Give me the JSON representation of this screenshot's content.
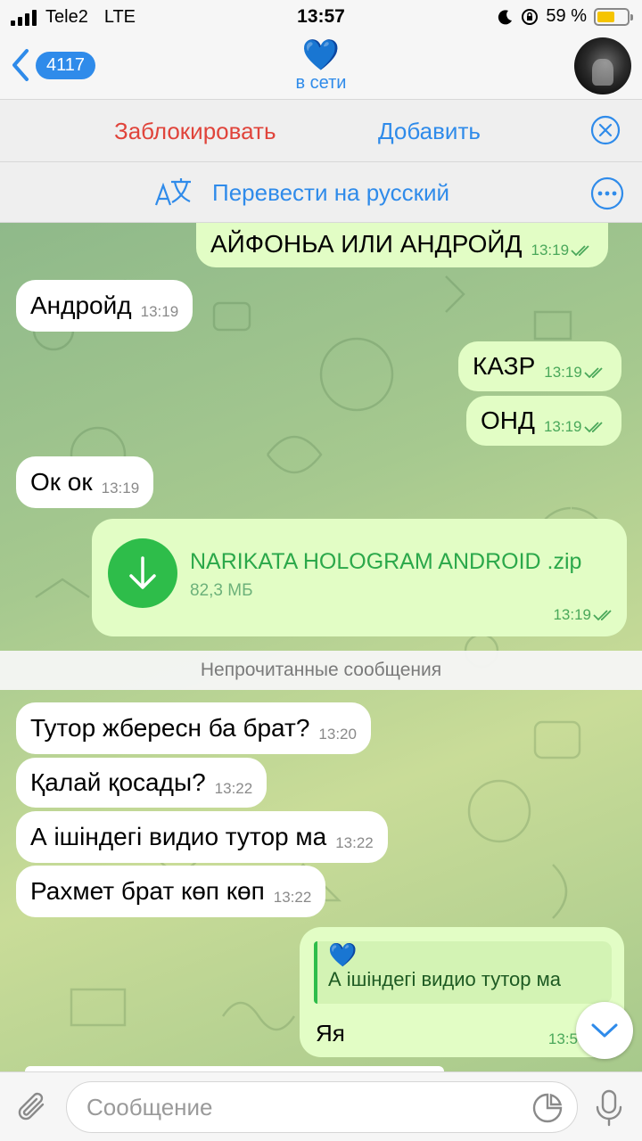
{
  "status_bar": {
    "carrier": "Tele2",
    "network": "LTE",
    "time": "13:57",
    "battery_percent": "59 %",
    "battery_level": 0.59
  },
  "header": {
    "back_count": "4117",
    "peer_emoji": "💙",
    "peer_status": "в сети"
  },
  "actions": {
    "block_label": "Заблокировать",
    "add_label": "Добавить"
  },
  "translate": {
    "label": "Перевести на русский"
  },
  "messages": [
    {
      "dir": "out",
      "text": "АЙФОНЬА ИЛИ АНДРОЙД",
      "time": "13:19"
    },
    {
      "dir": "in",
      "text": "Андройд",
      "time": "13:19"
    },
    {
      "dir": "out",
      "text": "КАЗР",
      "time": "13:19"
    },
    {
      "dir": "out",
      "text": "ОНД",
      "time": "13:19"
    },
    {
      "dir": "in",
      "text": "Ок ок",
      "time": "13:19"
    }
  ],
  "file_message": {
    "name": "NARIKATA HOLOGRAM ANDROID .zip",
    "size": "82,3 МБ",
    "time": "13:19"
  },
  "unread_divider": "Непрочитанные сообщения",
  "unread_messages": [
    {
      "dir": "in",
      "text": "Тутор жбересн ба брат?",
      "time": "13:20"
    },
    {
      "dir": "in",
      "text": "Қалай қосады?",
      "time": "13:22"
    },
    {
      "dir": "in",
      "text": "А ішіндегі видио тутор ма",
      "time": "13:22"
    },
    {
      "dir": "in",
      "text": "Рахмет брат көп көп",
      "time": "13:22"
    }
  ],
  "reply_message": {
    "quote_author": "💙",
    "quote_text": "А ішіндегі видио тутор ма",
    "text": "Яя",
    "time": "13:5"
  },
  "composer": {
    "placeholder": "Сообщение"
  },
  "colors": {
    "accent": "#2f8bea",
    "danger": "#e0443b",
    "outgoing": "#e2fdc5",
    "download": "#2ebd4a"
  }
}
